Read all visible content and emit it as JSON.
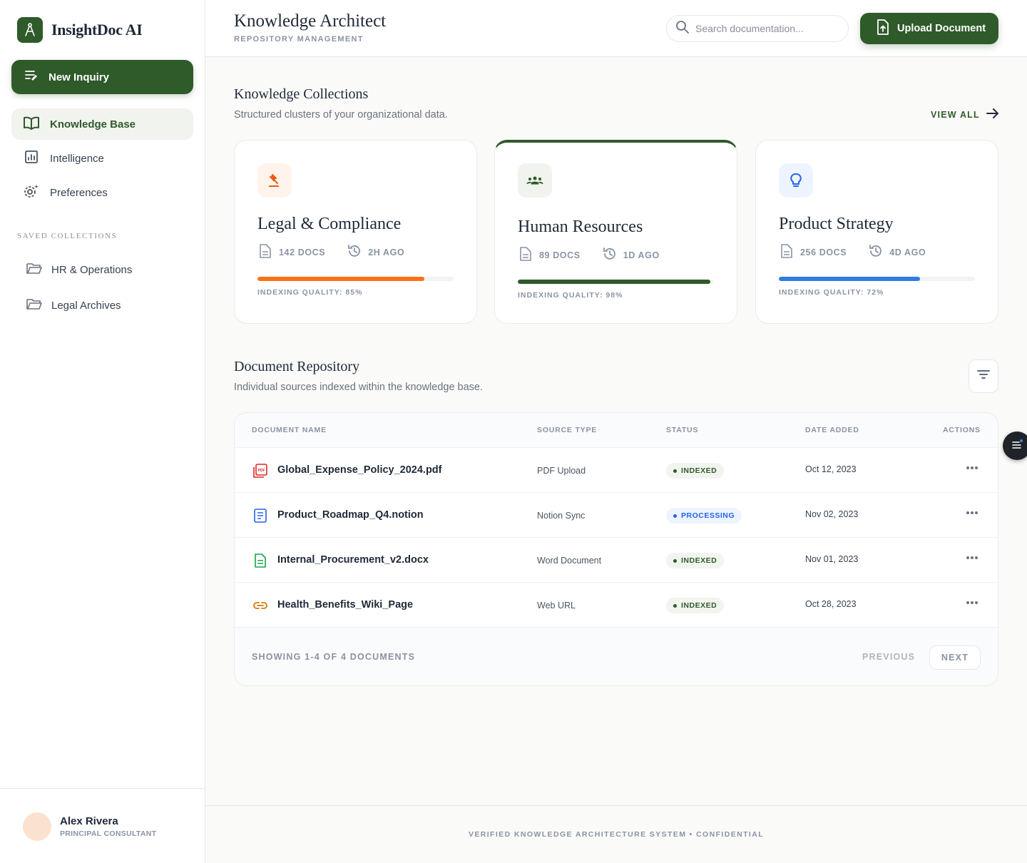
{
  "brand": {
    "name": "InsightDoc AI"
  },
  "sidebar": {
    "new_inquiry": "New Inquiry",
    "nav": [
      {
        "label": "Knowledge Base",
        "icon": "book-open-icon",
        "active": true
      },
      {
        "label": "Intelligence",
        "icon": "chart-icon",
        "active": false
      },
      {
        "label": "Preferences",
        "icon": "gear-icon",
        "active": false
      }
    ],
    "saved_title": "Saved Collections",
    "saved": [
      {
        "label": "HR & Operations",
        "icon": "folder-icon"
      },
      {
        "label": "Legal Archives",
        "icon": "folder-icon"
      }
    ],
    "user": {
      "name": "Alex Rivera",
      "role": "PRINCIPAL CONSULTANT"
    }
  },
  "header": {
    "title": "Knowledge Architect",
    "subtitle": "REPOSITORY MANAGEMENT",
    "search_placeholder": "Search documentation...",
    "upload_label": "Upload Document"
  },
  "collections": {
    "title": "Knowledge Collections",
    "subtitle": "Structured clusters of your organizational data.",
    "view_all": "VIEW ALL",
    "cards": [
      {
        "title": "Legal & Compliance",
        "docs": "142 DOCS",
        "updated": "2H AGO",
        "quality_label": "INDEXING QUALITY: 85%",
        "quality": 0.85,
        "color": "#f97316",
        "icon_bg": "#fff4ec",
        "icon": "gavel-icon"
      },
      {
        "title": "Human Resources",
        "docs": "89 DOCS",
        "updated": "1D AGO",
        "quality_label": "INDEXING QUALITY: 98%",
        "quality": 0.98,
        "color": "#2f5a2a",
        "icon_bg": "#f1f3ef",
        "icon": "group-icon"
      },
      {
        "title": "Product Strategy",
        "docs": "256 DOCS",
        "updated": "4D AGO",
        "quality_label": "INDEXING QUALITY: 72%",
        "quality": 0.72,
        "color": "#2f7de1",
        "icon_bg": "#eef4ff",
        "icon": "lightbulb-icon"
      }
    ]
  },
  "repository": {
    "title": "Document Repository",
    "subtitle": "Individual sources indexed within the knowledge base.",
    "columns": [
      "DOCUMENT NAME",
      "SOURCE TYPE",
      "STATUS",
      "DATE ADDED",
      "ACTIONS"
    ],
    "rows": [
      {
        "name": "Global_Expense_Policy_2024.pdf",
        "source": "PDF Upload",
        "status": "INDEXED",
        "date": "Oct 12, 2023",
        "icon": "pdf-icon"
      },
      {
        "name": "Product_Roadmap_Q4.notion",
        "source": "Notion Sync",
        "status": "PROCESSING",
        "date": "Nov 02, 2023",
        "icon": "doc-icon"
      },
      {
        "name": "Internal_Procurement_v2.docx",
        "source": "Word Document",
        "status": "INDEXED",
        "date": "Nov 01, 2023",
        "icon": "word-icon"
      },
      {
        "name": "Health_Benefits_Wiki_Page",
        "source": "Web URL",
        "status": "INDEXED",
        "date": "Oct 28, 2023",
        "icon": "link-icon"
      }
    ],
    "showing": "SHOWING 1-4 OF 4 DOCUMENTS",
    "previous": "PREVIOUS",
    "next": "NEXT"
  },
  "footer": {
    "text": "VERIFIED KNOWLEDGE ARCHITECTURE SYSTEM • CONFIDENTIAL"
  }
}
